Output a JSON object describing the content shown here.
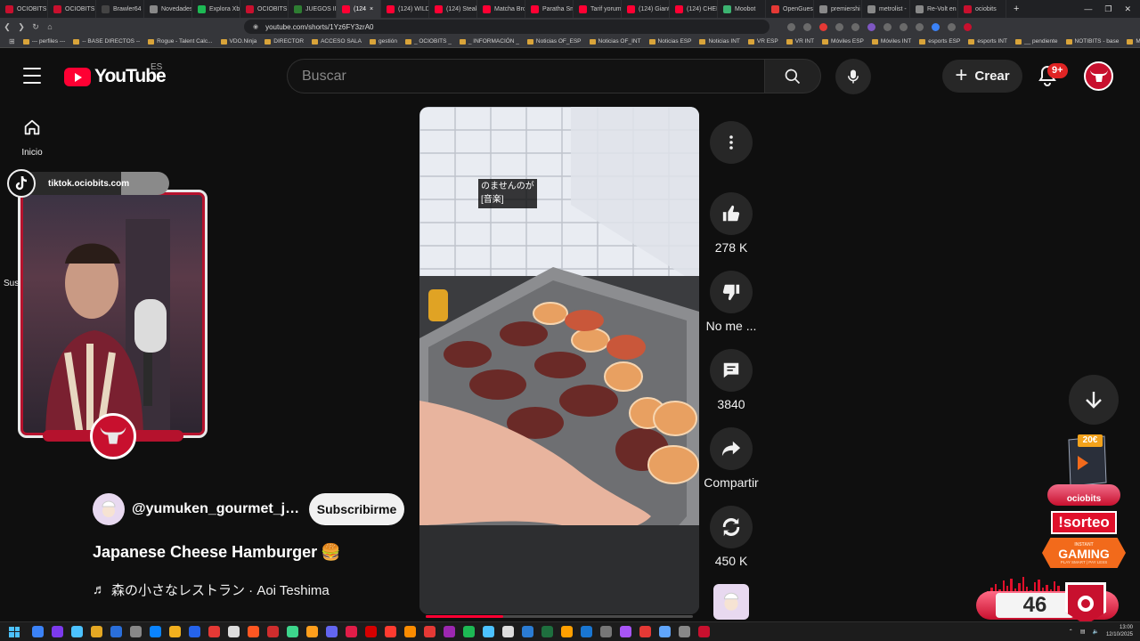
{
  "browser": {
    "tabs": [
      {
        "label": "OCIOBITS",
        "color": "#c8102e"
      },
      {
        "label": "OCIOBITS",
        "color": "#c8102e"
      },
      {
        "label": "Brawler64 I",
        "color": "#444"
      },
      {
        "label": "Novedades",
        "color": "#888"
      },
      {
        "label": "Explora Xb",
        "color": "#1db954"
      },
      {
        "label": "OCIOBITS",
        "color": "#c8102e"
      },
      {
        "label": "JUEGOS IM",
        "color": "#2e7d32"
      },
      {
        "label": "(124",
        "color": "#ff0033",
        "active": true
      },
      {
        "label": "(124) WILD",
        "color": "#ff0033"
      },
      {
        "label": "(124) Steak",
        "color": "#ff0033"
      },
      {
        "label": "Matcha Bro",
        "color": "#ff0033"
      },
      {
        "label": "Paratha Sm",
        "color": "#ff0033"
      },
      {
        "label": "Tarif yorum",
        "color": "#ff0033"
      },
      {
        "label": "(124) Giant",
        "color": "#ff0033"
      },
      {
        "label": "(124) CHEE",
        "color": "#ff0033"
      },
      {
        "label": "Moobot",
        "color": "#3cb371"
      },
      {
        "label": "OpenGuess",
        "color": "#e53935"
      },
      {
        "label": "premiershi",
        "color": "#888"
      },
      {
        "label": "metrolist -",
        "color": "#888"
      },
      {
        "label": "Re-Volt en",
        "color": "#888"
      },
      {
        "label": "ociobits",
        "color": "#c8102e"
      }
    ],
    "url": "youtube.com/shorts/1Yz6FY3zrA0",
    "bookmarks": [
      "--- perfiles ---",
      "-- BASE DIRECTOS --",
      "Rogue - Talent Calc...",
      "VDO.Ninja",
      "DIRECTOR",
      "ACCESO SALA",
      "gestión",
      "_ OCIOBITS _",
      "_ INFORMACIÓN _",
      "Noticias OF_ESP",
      "Noticias OF_INT",
      "Noticias ESP",
      "Noticias INT",
      "VR ESP",
      "VR INT",
      "Móviles ESP",
      "Móviles INT",
      "esports ESP",
      "esports INT",
      "__ pendiente",
      "NOTIBITS - base",
      "MISA - base"
    ]
  },
  "header": {
    "logo_text": "YouTube",
    "region": "ES",
    "search_placeholder": "Buscar",
    "create_label": "Crear",
    "notifications_badge": "9+"
  },
  "sidebar": {
    "home_label": "Inicio",
    "subs_label": "Sus"
  },
  "overlay": {
    "tiktok_handle": "tiktok.ociobits.com"
  },
  "video": {
    "caption_line1": "のませんのが",
    "caption_line2": "[音楽]",
    "progress": 0.29,
    "channel_name": "@yumuken_gourmet_jap...",
    "subscribe_label": "Subscribirme",
    "title": "Japanese Cheese Hamburger",
    "title_emoji": "🍔",
    "music": "森の小さなレストラン · Aoi Teshima",
    "music_icon": "♬"
  },
  "actions": {
    "likes": "278 K",
    "dislike_label": "No me ...",
    "comments": "3840",
    "share_label": "Compartir",
    "remix_count": "450 K"
  },
  "promo": {
    "price": "20€",
    "brand": "ociobits",
    "sorteo": "!sorteo",
    "gaming_top": "INSTANT",
    "gaming_main": "GAMING",
    "gaming_sub": "PLAY SMART | PAY LESS",
    "counter": "46"
  },
  "taskbar": {
    "time": "13:00",
    "date": "12/10/2025",
    "icon_colors": [
      "#3b82f6",
      "#7c3aed",
      "#4cc2ff",
      "#e5a823",
      "#2a6fdb",
      "#888",
      "#0a84ff",
      "#f2b01e",
      "#2563eb",
      "#e53935",
      "#ddd",
      "#ff5722",
      "#cf2d2d",
      "#3dd68c",
      "#ff9f1c",
      "#6366f1",
      "#e11d48",
      "#d50000",
      "#ff3b30",
      "#fb8c00",
      "#e53935",
      "#9c27b0",
      "#1db954",
      "#4cc2ff",
      "#ddd",
      "#2b7cd3",
      "#1e6f3e",
      "#ffa000",
      "#1976d2",
      "#777",
      "#a855f7",
      "#e53935",
      "#60a5fa",
      "#888",
      "#c8102e"
    ]
  }
}
